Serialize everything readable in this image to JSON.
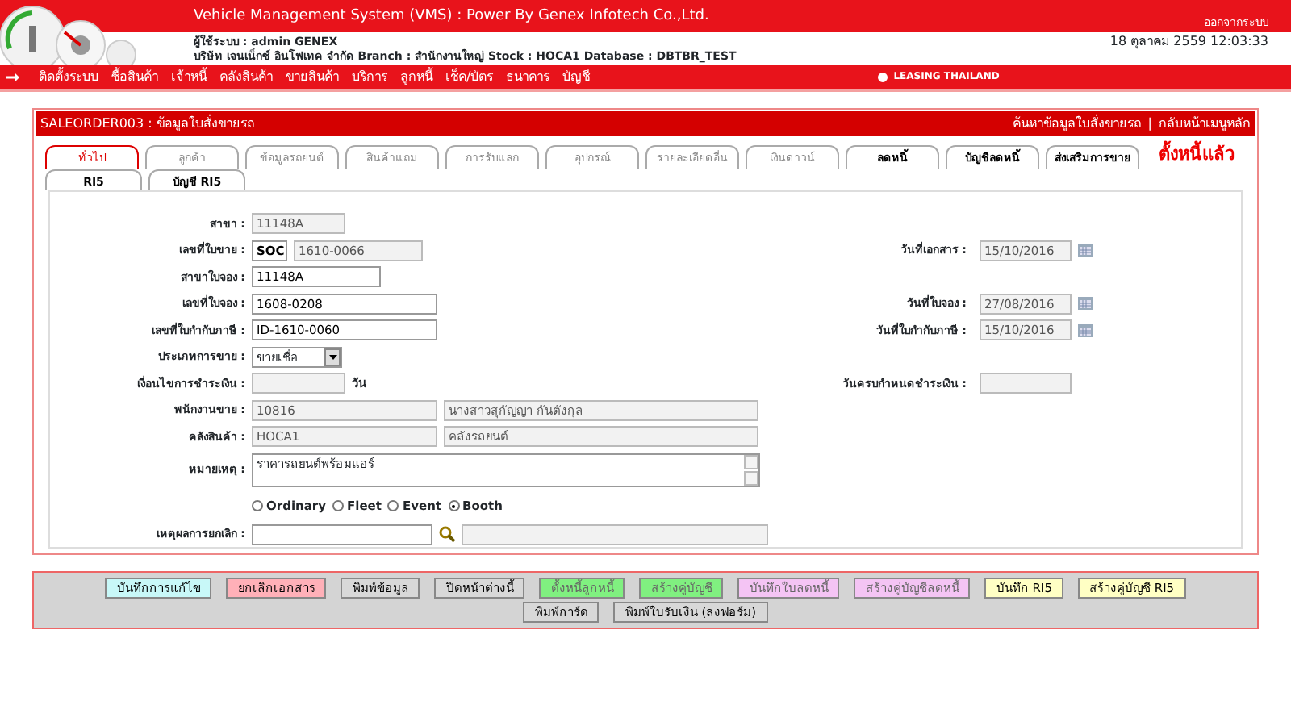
{
  "header": {
    "title": "Vehicle Management System (VMS)  : Power By Genex Infotech Co.,Ltd.",
    "logout": "ออกจากระบบ",
    "user": "ผู้ใช้ระบบ : admin GENEX",
    "company": "บริษัท เจนเน็กซ์ อินโฟเทค จำกัด Branch : สำนักงานใหญ่ Stock : HOCA1 Database : DBTBR_TEST",
    "datetime": "18 ตุลาคม 2559 12:03:33"
  },
  "menu": {
    "items": [
      "ติดตั้งระบบ",
      "ซื้อสินค้า",
      "เจ้าหนี้",
      "คลังสินค้า",
      "ขายสินค้า",
      "บริการ",
      "ลูกหนี้",
      "เช็ค/บัตร",
      "ธนาคาร",
      "บัญชี"
    ],
    "brand": "LEASING THAILAND"
  },
  "panel": {
    "title": "SALEORDER003 : ข้อมูลใบสั่งขายรถ",
    "links": [
      "ค้นหาข้อมูลใบสั่งขายรถ",
      "กลับหน้าเมนูหลัก"
    ],
    "separator": "|",
    "tabs": [
      {
        "label": "ทั่วไป",
        "selected": true,
        "bold": false
      },
      {
        "label": "ลูกค้า",
        "selected": false,
        "bold": false
      },
      {
        "label": "ข้อมูลรถยนต์",
        "selected": false,
        "bold": false
      },
      {
        "label": "สินค้าแถม",
        "selected": false,
        "bold": false
      },
      {
        "label": "การรับแลก",
        "selected": false,
        "bold": false
      },
      {
        "label": "อุปกรณ์",
        "selected": false,
        "bold": false
      },
      {
        "label": "รายละเอียดอื่น",
        "selected": false,
        "bold": false
      },
      {
        "label": "เงินดาวน์",
        "selected": false,
        "bold": false
      },
      {
        "label": "ลดหนี้",
        "selected": false,
        "bold": true
      },
      {
        "label": "บัญชีลดหนี้",
        "selected": false,
        "bold": true
      },
      {
        "label": "ส่งเสริมการขาย",
        "selected": false,
        "bold": true
      }
    ],
    "subtabs": [
      {
        "label": "RI5",
        "selected": false
      },
      {
        "label": "บัญชี RI5",
        "selected": false
      }
    ],
    "status": "ตั้งหนี้แล้ว"
  },
  "form": {
    "rows": [
      {
        "label": "สาขา :",
        "inputs": [
          {
            "kind": "short",
            "value": "11148A",
            "disabled": true
          }
        ]
      },
      {
        "label": "เลขที่ใบขาย :",
        "inputs": [
          {
            "kind": "prefix",
            "value": "SOC",
            "disabled": false
          },
          {
            "kind": "text",
            "value": "1610-0066",
            "disabled": true
          }
        ],
        "right": {
          "label": "วันที่เอกสาร :",
          "value": "15/10/2016",
          "disabled": true,
          "calendar": true
        }
      },
      {
        "label": "สาขาใบจอง :",
        "inputs": [
          {
            "kind": "text",
            "value": "11148A",
            "disabled": false
          }
        ]
      },
      {
        "label": "เลขที่ใบจอง :",
        "inputs": [
          {
            "kind": "long",
            "value": "1608-0208",
            "disabled": false
          }
        ],
        "right": {
          "label": "วันที่ใบจอง :",
          "value": "27/08/2016",
          "disabled": true,
          "calendar": true
        }
      },
      {
        "label": "เลขที่ใบกำกับภาษี :",
        "inputs": [
          {
            "kind": "long",
            "value": "ID-1610-0060",
            "disabled": false
          }
        ],
        "right": {
          "label": "วันที่ใบกำกับภาษี :",
          "value": "15/10/2016",
          "disabled": true,
          "calendar": true
        }
      },
      {
        "label": "ประเภทการขาย :",
        "inputs": [
          {
            "kind": "select",
            "value": "ขายเชื่อ",
            "disabled": false
          }
        ]
      },
      {
        "label": "เงื่อนไขการชำระเงิน :",
        "inputs": [
          {
            "kind": "short",
            "disabled": true
          },
          {
            "kind": "unit",
            "value": "วัน"
          }
        ],
        "right": {
          "label": "วันครบกำหนดชำระเงิน :",
          "disabled": true,
          "calendar": false
        }
      },
      {
        "label": "พนักงานขาย :",
        "inputs": [
          {
            "kind": "long",
            "value": "10816",
            "disabled": true
          },
          {
            "kind": "wide",
            "value": "นางสาวสุกัญญา  กันตังกุล",
            "disabled": true
          }
        ]
      },
      {
        "label": "คลังสินค้า :",
        "inputs": [
          {
            "kind": "long",
            "value": "HOCA1",
            "disabled": true
          },
          {
            "kind": "wide",
            "value": "คลังรถยนต์",
            "disabled": true
          }
        ]
      },
      {
        "label": "หมายเหตุ :",
        "inputs": [
          {
            "kind": "textarea",
            "value": "ราคารถยนต์พร้อมแอร์",
            "disabled": false
          }
        ]
      },
      {
        "inputs": [
          {
            "kind": "radios",
            "options": [
              {
                "label": "Ordinary",
                "selected": false
              },
              {
                "label": "Fleet",
                "selected": false
              },
              {
                "label": "Event",
                "selected": false
              },
              {
                "label": "Booth",
                "selected": true
              }
            ]
          }
        ]
      },
      {
        "label": "เหตุผลการยกเลิก :",
        "inputs": [
          {
            "kind": "long",
            "disabled": false
          },
          {
            "kind": "search"
          },
          {
            "kind": "wide",
            "disabled": true
          }
        ]
      }
    ]
  },
  "buttons": [
    {
      "label": "บันทึกการแก้ไข",
      "color": "#c8f8f8",
      "disabled": false
    },
    {
      "label": "ยกเลิกเอกสาร",
      "color": "#ffb0b8",
      "disabled": false
    },
    {
      "label": "พิมพ์ข้อมูล",
      "color": "#d8d8d8",
      "disabled": false
    },
    {
      "label": "ปิดหน้าต่างนี้",
      "color": "#d8d8d8",
      "disabled": false
    },
    {
      "label": "ตั้งหนี้ลูกหนี้",
      "color": "#80f080",
      "disabled": true
    },
    {
      "label": "สร้างคู่บัญชี",
      "color": "#80f080",
      "disabled": true
    },
    {
      "label": "บันทึกใบลดหนี้",
      "color": "#f4c4f4",
      "disabled": true
    },
    {
      "label": "สร้างคู่บัญชีลดหนี้",
      "color": "#f4c4f4",
      "disabled": true
    },
    {
      "label": "บันทึก RI5",
      "color": "#ffffc4",
      "disabled": false
    },
    {
      "label": "สร้างคู่บัญชี RI5",
      "color": "#ffffc4",
      "disabled": false
    },
    {
      "label": "พิมพ์การ์ด",
      "color": "#d8d8d8",
      "disabled": false
    },
    {
      "label": "พิมพ์ใบรับเงิน (ลงฟอร์ม)",
      "color": "#d8d8d8",
      "disabled": false
    }
  ]
}
